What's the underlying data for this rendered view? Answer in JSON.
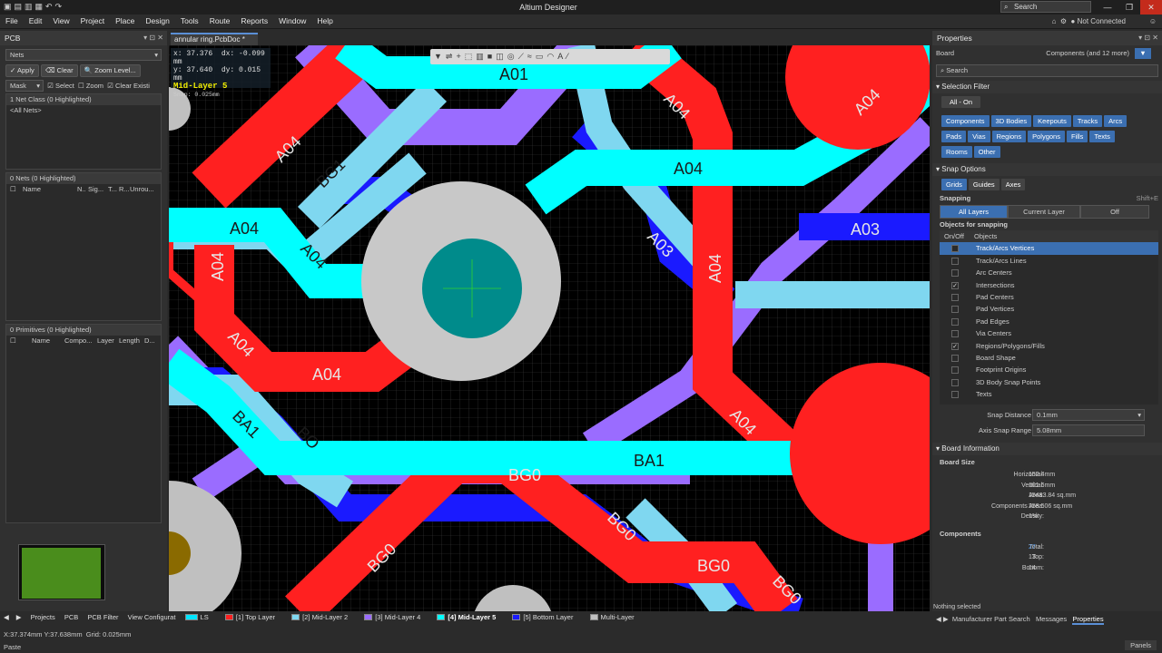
{
  "app": {
    "title": "Altium Designer",
    "search": "Search",
    "not_connected": "Not Connected",
    "panels": "Panels"
  },
  "menu": [
    "File",
    "Edit",
    "View",
    "Project",
    "Place",
    "Design",
    "Tools",
    "Route",
    "Reports",
    "Window",
    "Help"
  ],
  "pcb_panel": {
    "title": "PCB",
    "nets_dropdown": "Nets",
    "apply": "Apply",
    "clear": "Clear",
    "zoom_level": "Zoom Level...",
    "mask": "Mask",
    "select": "Select",
    "zoom": "Zoom",
    "clear_existing": "Clear Existi",
    "net_class_header": "1 Net Class (0 Highlighted)",
    "all_nets": "<All Nets>",
    "nets_header": "0 Nets (0 Highlighted)",
    "nets_cols": [
      "Name",
      "N..",
      "Sig...",
      "T...",
      "R...",
      "Unrou..."
    ],
    "primitives_header": "0 Primitives (0 Highlighted)",
    "prim_cols": [
      "Name",
      "Compo...",
      "Layer",
      "Length",
      "D..."
    ]
  },
  "doc_tab": "annular ring.PcbDoc *",
  "hud": {
    "x": "x: 37.376",
    "dx": "dx: -0.099 mm",
    "y": "y: 37.640",
    "dy": "dy:  0.015 mm",
    "layer": "Mid-Layer 5",
    "snap": "Snap: 0.025mm"
  },
  "toolbar_icons": [
    "filter-icon",
    "route-icon",
    "add-icon",
    "select-rect-icon",
    "chart-icon",
    "region-icon",
    "pad-icon",
    "via-icon",
    "interactive-route-icon",
    "diff-pair-icon",
    "polygon-icon",
    "arc-icon",
    "string-icon",
    "line-icon"
  ],
  "labels": {
    "a01": "A01",
    "a04": "A04",
    "a03": "A03",
    "bg1": "BG1",
    "ba1": "BA1",
    "bg0": "BG0",
    "bo": "BO"
  },
  "bottom_tabs": [
    "Projects",
    "PCB",
    "PCB Filter",
    "View Configurat"
  ],
  "layers": [
    {
      "label": "LS",
      "color": "#00e5ff"
    },
    {
      "label": "[1] Top Layer",
      "color": "#ff2020"
    },
    {
      "label": "[2] Mid-Layer 2",
      "color": "#7fd7f0"
    },
    {
      "label": "[3] Mid-Layer 4",
      "color": "#9a6cff"
    },
    {
      "label": "[4] Mid-Layer 5",
      "color": "#00ffff"
    },
    {
      "label": "[5] Bottom Layer",
      "color": "#1a1aff"
    },
    {
      "label": "Multi-Layer",
      "color": "#c0c0c0"
    }
  ],
  "status": {
    "coords": "X:37.374mm Y:37.638mm",
    "grid": "Grid: 0.025mm",
    "mode": "Paste",
    "nothing_selected": "Nothing selected"
  },
  "props": {
    "title": "Properties",
    "board": "Board",
    "components_filter": "Components (and 12 more)",
    "search_placeholder": "Search",
    "selection_filter": "Selection Filter",
    "all_on": "All - On",
    "filter_chips": [
      "Components",
      "3D Bodies",
      "Keepouts",
      "Tracks",
      "Arcs",
      "Pads",
      "Vias",
      "Regions",
      "Polygons",
      "Fills",
      "Texts",
      "Rooms",
      "Other"
    ],
    "snap_options": "Snap Options",
    "grids": "Grids",
    "guides": "Guides",
    "axes": "Axes",
    "snapping": "Snapping",
    "shortcut": "Shift+E",
    "all_layers": "All Layers",
    "current_layer": "Current Layer",
    "off": "Off",
    "objects_for_snapping": "Objects for snapping",
    "on_off": "On/Off",
    "objects": "Objects",
    "snap_objects": [
      {
        "label": "Track/Arcs Vertices",
        "checked": false,
        "selected": true
      },
      {
        "label": "Track/Arcs Lines",
        "checked": false
      },
      {
        "label": "Arc Centers",
        "checked": false
      },
      {
        "label": "Intersections",
        "checked": true
      },
      {
        "label": "Pad Centers",
        "checked": false
      },
      {
        "label": "Pad Vertices",
        "checked": false
      },
      {
        "label": "Pad Edges",
        "checked": false
      },
      {
        "label": "Via Centers",
        "checked": false
      },
      {
        "label": "Regions/Polygons/Fills",
        "checked": true
      },
      {
        "label": "Board Shape",
        "checked": false
      },
      {
        "label": "Footprint Origins",
        "checked": false
      },
      {
        "label": "3D Body Snap Points",
        "checked": false
      },
      {
        "label": "Texts",
        "checked": false
      }
    ],
    "snap_distance_label": "Snap Distance",
    "snap_distance": "0.1mm",
    "axis_snap_label": "Axis Snap Range",
    "axis_snap": "5.08mm",
    "board_info": "Board Information",
    "board_size": "Board Size",
    "board_rows": [
      {
        "k": "Horizontal:",
        "v": "152.4mm"
      },
      {
        "k": "Vertical:",
        "v": "101.6mm"
      },
      {
        "k": "Area:",
        "v": "15483.84 sq.mm"
      },
      {
        "k": "Components Area:",
        "v": "258.506 sq.mm"
      },
      {
        "k": "Density:",
        "v": "1%"
      }
    ],
    "components": "Components",
    "comp_rows": [
      {
        "k": "Total:",
        "v": "27"
      },
      {
        "k": "Top:",
        "v": "13"
      },
      {
        "k": "Bottom:",
        "v": "14"
      }
    ],
    "bottom_tabs": [
      "Manufacturer Part Search",
      "Messages",
      "Properties"
    ]
  }
}
